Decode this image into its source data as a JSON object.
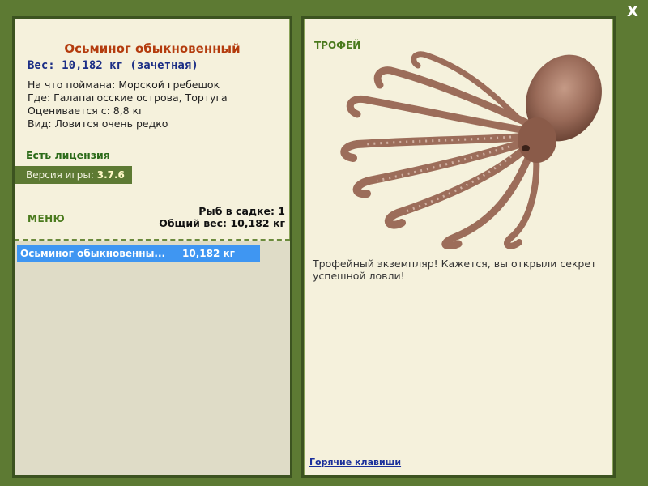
{
  "window": {
    "close_label": "X"
  },
  "fish": {
    "title": "Осьминог обыкновенный",
    "weight": "Вес: 10,182 кг (зачетная)",
    "caught_on": "На что поймана: Морской гребешок",
    "location": "Где: Галапагосские острова, Тортуга",
    "valued_from": "Оценивается с: 8,8 кг",
    "rarity": "Вид: Ловится очень редко"
  },
  "license": "Есть лицензия",
  "version": {
    "label": "Версия игры:",
    "value": "3.7.6"
  },
  "menu_label": "МЕНЮ",
  "catch_summary": {
    "count": "Рыб в садке: 1",
    "total_weight": "Общий вес: 10,182 кг"
  },
  "catch_list": [
    {
      "name": "Осьминог обыкновенны...",
      "weight": "10,182 кг"
    }
  ],
  "trophy": {
    "label": "ТРОФЕЙ",
    "text": "Трофейный экземпляр! Кажется, вы открыли секрет успешной ловли!",
    "image_icon": "octopus-icon"
  },
  "hotkeys_link": "Горячие клавиши",
  "colors": {
    "frame": "#5d7a33",
    "panel": "#f5f1dc",
    "title": "#b43c0e",
    "weight": "#1c2f86",
    "selection": "#3f96f2"
  }
}
